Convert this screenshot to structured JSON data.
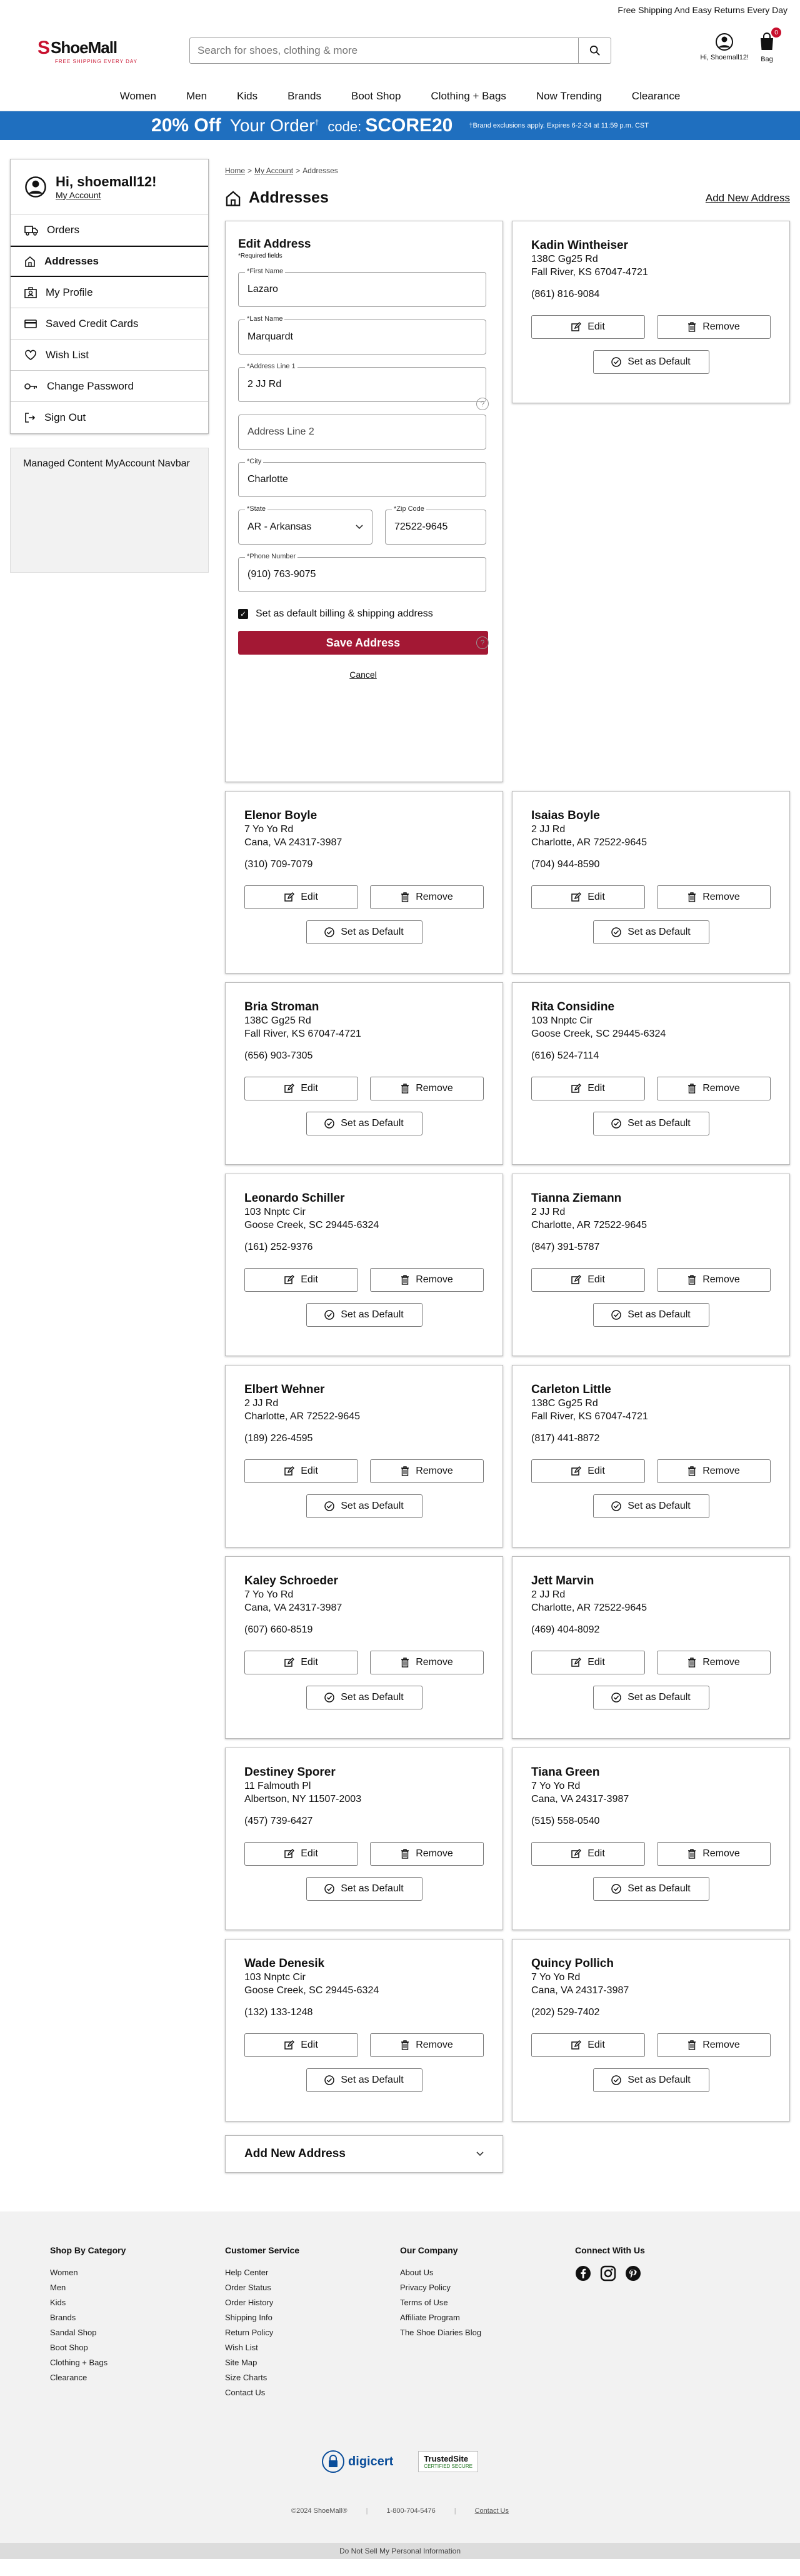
{
  "topbar": {
    "text": "Free Shipping And Easy Returns Every Day"
  },
  "logo": {
    "name": "ShoeMall",
    "tagline": "FREE SHIPPING EVERY DAY"
  },
  "search": {
    "placeholder": "Search for shoes, clothing & more"
  },
  "header": {
    "account_label": "Hi, Shoemall12!",
    "bag_label": "Bag",
    "bag_count": "0"
  },
  "nav": [
    "Women",
    "Men",
    "Kids",
    "Brands",
    "Boot Shop",
    "Clothing + Bags",
    "Now Trending",
    "Clearance"
  ],
  "promo": {
    "big": "20% Off",
    "mid": "Your Order",
    "sup": "†",
    "code_label": "code:",
    "code": "SCORE20",
    "fine": "†Brand exclusions apply. Expires 6-2-24 at 11:59 p.m. CST"
  },
  "sidebar": {
    "greeting": "Hi, shoemall12!",
    "account_link": "My Account",
    "items": [
      "Orders",
      "Addresses",
      "My Profile",
      "Saved Credit Cards",
      "Wish List",
      "Change Password",
      "Sign Out"
    ],
    "managed": "Managed Content MyAccount Navbar"
  },
  "breadcrumb": {
    "home": "Home",
    "account": "My Account",
    "current": "Addresses"
  },
  "page": {
    "title": "Addresses",
    "add_link": "Add New Address"
  },
  "form": {
    "title": "Edit Address",
    "required_note": "*Required fields",
    "first_name": {
      "label": "*First Name",
      "value": "Lazaro"
    },
    "last_name": {
      "label": "*Last Name",
      "value": "Marquardt"
    },
    "address1": {
      "label": "*Address Line 1",
      "value": "2 JJ Rd"
    },
    "address2": {
      "placeholder": "Address Line 2"
    },
    "city": {
      "label": "*City",
      "value": "Charlotte"
    },
    "state": {
      "label": "*State",
      "value": "AR - Arkansas"
    },
    "zip": {
      "label": "*Zip Code",
      "value": "72522-9645"
    },
    "phone": {
      "label": "*Phone Number",
      "value": "(910) 763-9075"
    },
    "default_checkbox": "Set as default billing & shipping address",
    "save": "Save Address",
    "cancel": "Cancel"
  },
  "buttons": {
    "edit": "Edit",
    "remove": "Remove",
    "default": "Set as Default"
  },
  "addresses": [
    {
      "name": "Kadin Wintheiser",
      "street": "138C Gg25 Rd",
      "city": "Fall River, KS 67047-4721",
      "phone": "(861) 816-9084"
    },
    {
      "name": "Elenor Boyle",
      "street": "7 Yo Yo Rd",
      "city": "Cana, VA 24317-3987",
      "phone": "(310) 709-7079"
    },
    {
      "name": "Isaias Boyle",
      "street": "2 JJ Rd",
      "city": "Charlotte, AR 72522-9645",
      "phone": "(704) 944-8590"
    },
    {
      "name": "Bria Stroman",
      "street": "138C Gg25 Rd",
      "city": "Fall River, KS 67047-4721",
      "phone": "(656) 903-7305"
    },
    {
      "name": "Rita Considine",
      "street": "103 Nnptc Cir",
      "city": "Goose Creek, SC 29445-6324",
      "phone": "(616) 524-7114"
    },
    {
      "name": "Leonardo Schiller",
      "street": "103 Nnptc Cir",
      "city": "Goose Creek, SC 29445-6324",
      "phone": "(161) 252-9376"
    },
    {
      "name": "Tianna Ziemann",
      "street": "2 JJ Rd",
      "city": "Charlotte, AR 72522-9645",
      "phone": "(847) 391-5787"
    },
    {
      "name": "Elbert Wehner",
      "street": "2 JJ Rd",
      "city": "Charlotte, AR 72522-9645",
      "phone": "(189) 226-4595"
    },
    {
      "name": "Carleton Little",
      "street": "138C Gg25 Rd",
      "city": "Fall River, KS 67047-4721",
      "phone": "(817) 441-8872"
    },
    {
      "name": "Kaley Schroeder",
      "street": "7 Yo Yo Rd",
      "city": "Cana, VA 24317-3987",
      "phone": "(607) 660-8519"
    },
    {
      "name": "Jett Marvin",
      "street": "2 JJ Rd",
      "city": "Charlotte, AR 72522-9645",
      "phone": "(469) 404-8092"
    },
    {
      "name": "Destiney Sporer",
      "street": "11 Falmouth Pl",
      "city": "Albertson, NY 11507-2003",
      "phone": "(457) 739-6427"
    },
    {
      "name": "Tiana Green",
      "street": "7 Yo Yo Rd",
      "city": "Cana, VA 24317-3987",
      "phone": "(515) 558-0540"
    },
    {
      "name": "Wade Denesik",
      "street": "103 Nnptc Cir",
      "city": "Goose Creek, SC 29445-6324",
      "phone": "(132) 133-1248"
    },
    {
      "name": "Quincy Pollich",
      "street": "7 Yo Yo Rd",
      "city": "Cana, VA 24317-3987",
      "phone": "(202) 529-7402"
    }
  ],
  "add_new_panel": "Add New Address",
  "footer": {
    "columns": [
      {
        "title": "Shop By Category",
        "links": [
          "Women",
          "Men",
          "Kids",
          "Brands",
          "Sandal Shop",
          "Boot Shop",
          "Clothing + Bags",
          "Clearance"
        ]
      },
      {
        "title": "Customer Service",
        "links": [
          "Help Center",
          "Order Status",
          "Order History",
          "Shipping Info",
          "Return Policy",
          "Wish List",
          "Site Map",
          "Size Charts",
          "Contact Us"
        ]
      },
      {
        "title": "Our Company",
        "links": [
          "About Us",
          "Privacy Policy",
          "Terms of Use",
          "Affiliate Program",
          "The Shoe Diaries Blog"
        ]
      }
    ],
    "connect_title": "Connect With Us",
    "digicert": "digicert",
    "trusted_site": "TrustedSite",
    "trusted_sub": "CERTIFIED SECURE",
    "copyright": "©2024 ShoeMall®",
    "phone": "1-800-704-5476",
    "contact": "Contact Us",
    "dnsp": "Do Not Sell My Personal Information"
  },
  "colors": {
    "accent_red": "#c8102e",
    "promo_blue": "#1f6fbf",
    "save_button": "#a31834"
  }
}
